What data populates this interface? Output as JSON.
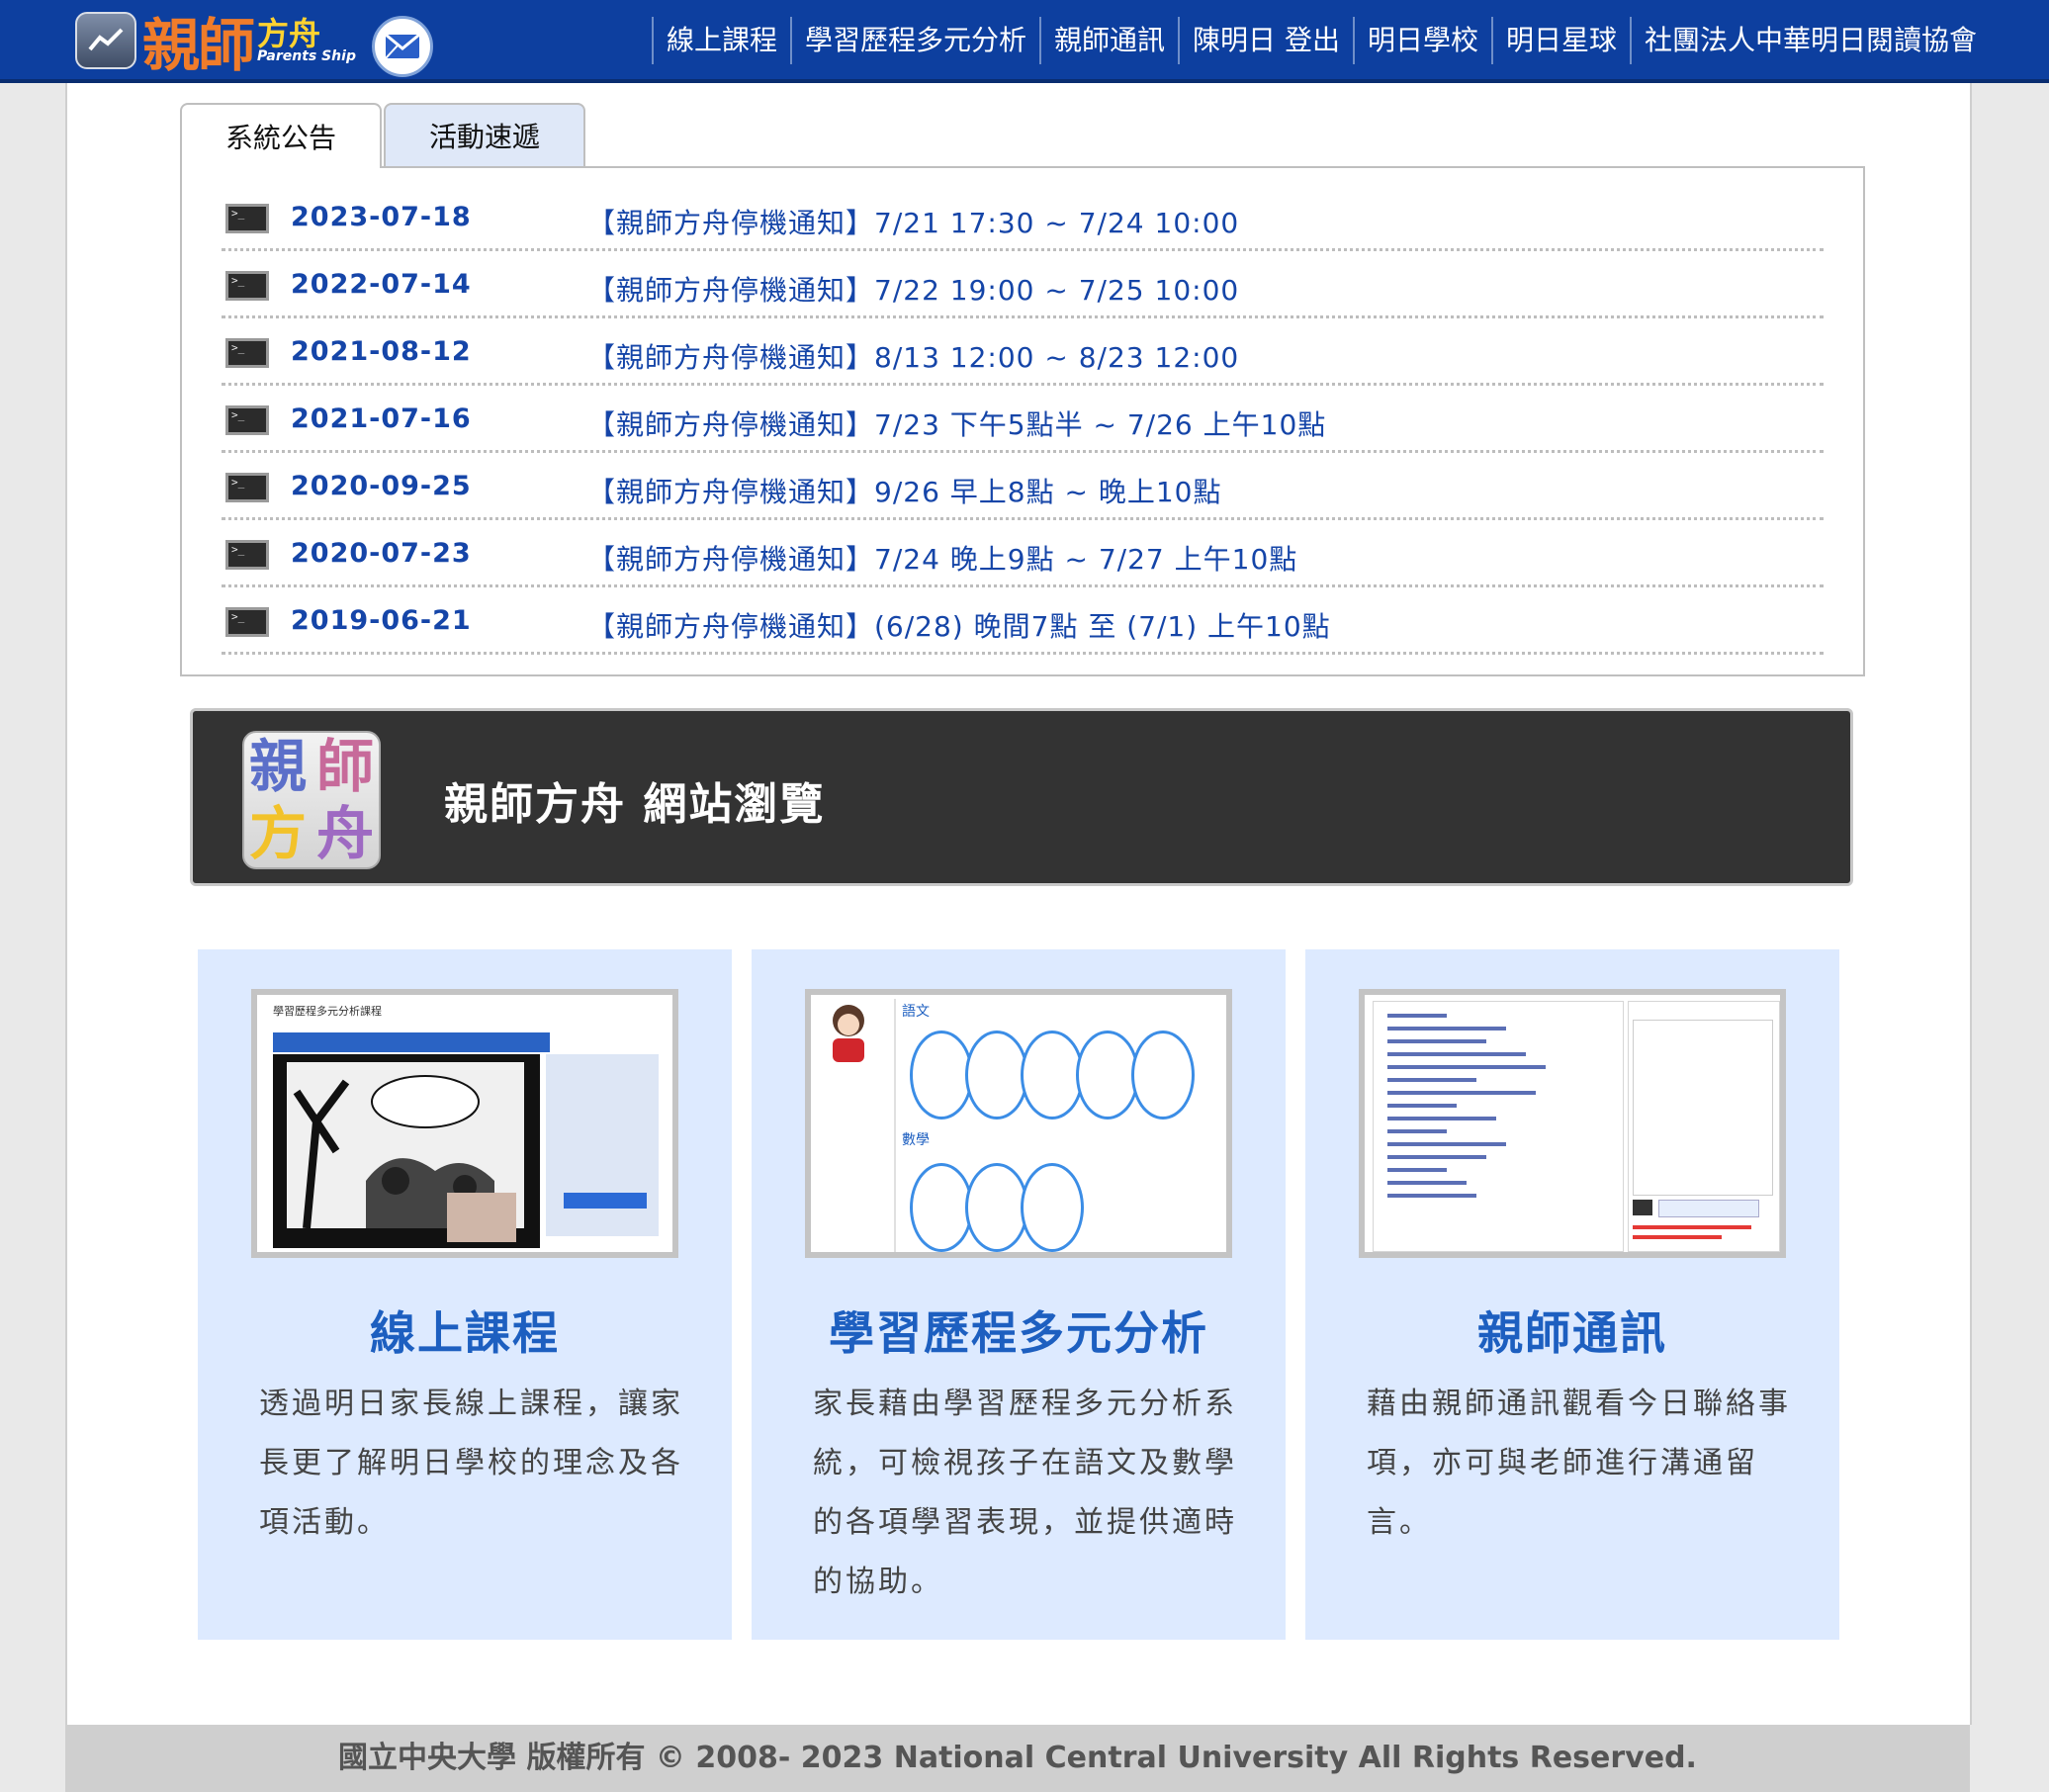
{
  "header": {
    "logo": {
      "text_main": "親師",
      "text_sub": "方舟",
      "text_en": "Parents Ship"
    },
    "nav": [
      "線上課程",
      "學習歷程多元分析",
      "親師通訊",
      "陳明日 登出",
      "明日學校",
      "明日星球",
      "社團法人中華明日閱讀協會"
    ]
  },
  "tabs": [
    "系統公告",
    "活動速遞"
  ],
  "announcements": [
    {
      "date": "2023-07-18",
      "title": "【親師方舟停機通知】7/21 17:30 ~ 7/24 10:00"
    },
    {
      "date": "2022-07-14",
      "title": "【親師方舟停機通知】7/22 19:00 ~ 7/25 10:00"
    },
    {
      "date": "2021-08-12",
      "title": "【親師方舟停機通知】8/13 12:00 ~ 8/23 12:00"
    },
    {
      "date": "2021-07-16",
      "title": "【親師方舟停機通知】7/23 下午5點半 ~ 7/26 上午10點"
    },
    {
      "date": "2020-09-25",
      "title": "【親師方舟停機通知】9/26 早上8點 ~ 晚上10點"
    },
    {
      "date": "2020-07-23",
      "title": "【親師方舟停機通知】7/24 晚上9點 ~ 7/27 上午10點"
    },
    {
      "date": "2019-06-21",
      "title": "【親師方舟停機通知】(6/28) 晚間7點 至 (7/1) 上午10點"
    }
  ],
  "banner": {
    "logo_chars": [
      "親",
      "師",
      "方",
      "舟"
    ],
    "title": "親師方舟 網站瀏覽"
  },
  "features": [
    {
      "title": "線上課程",
      "desc": "透過明日家長線上課程，讓家長更了解明日學校的理念及各項活動。",
      "thumb_heading": "學習歷程多元分析課程"
    },
    {
      "title": "學習歷程多元分析",
      "desc": "家長藉由學習歷程多元分析系統，可檢視孩子在語文及數學的各項學習表現，並提供適時的協助。",
      "thumb_sections": [
        "語文",
        "數學"
      ]
    },
    {
      "title": "親師通訊",
      "desc": "藉由親師通訊觀看今日聯絡事項，亦可與老師進行溝通留言。"
    }
  ],
  "footer": "國立中央大學 版權所有 © 2008- 2023 National Central University All Rights Reserved.",
  "colors": {
    "header_bg": "#0d3f9f",
    "link_blue": "#1545a8",
    "card_bg": "#ddeaff",
    "card_title": "#1d5fc0",
    "banner_bg": "#333333"
  }
}
